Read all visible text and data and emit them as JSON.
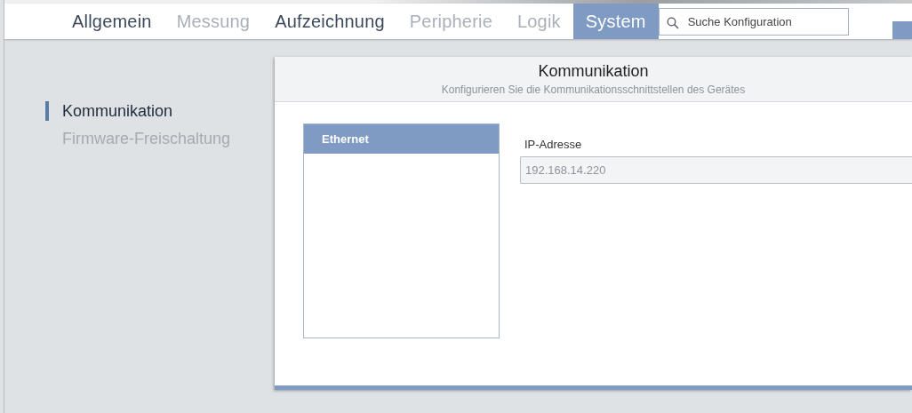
{
  "tabs": [
    {
      "label": "Allgemein",
      "selected": false,
      "disabled": false
    },
    {
      "label": "Messung",
      "selected": false,
      "disabled": true
    },
    {
      "label": "Aufzeichnung",
      "selected": false,
      "disabled": false
    },
    {
      "label": "Peripherie",
      "selected": false,
      "disabled": true
    },
    {
      "label": "Logik",
      "selected": false,
      "disabled": true
    },
    {
      "label": "System",
      "selected": true,
      "disabled": false
    }
  ],
  "search": {
    "placeholder": "Suche Konfiguration"
  },
  "sidebar": {
    "items": [
      {
        "label": "Kommunikation",
        "selected": true
      },
      {
        "label": "Firmware-Freischaltung",
        "selected": false
      }
    ]
  },
  "panel": {
    "title": "Kommunikation",
    "subtitle": "Konfigurieren Sie die Kommunikationsschnittstellen des Gerätes",
    "interfaces": [
      {
        "label": "Ethernet",
        "selected": true
      }
    ],
    "field": {
      "label": "IP-Adresse",
      "value": "192.168.14.220"
    }
  }
}
